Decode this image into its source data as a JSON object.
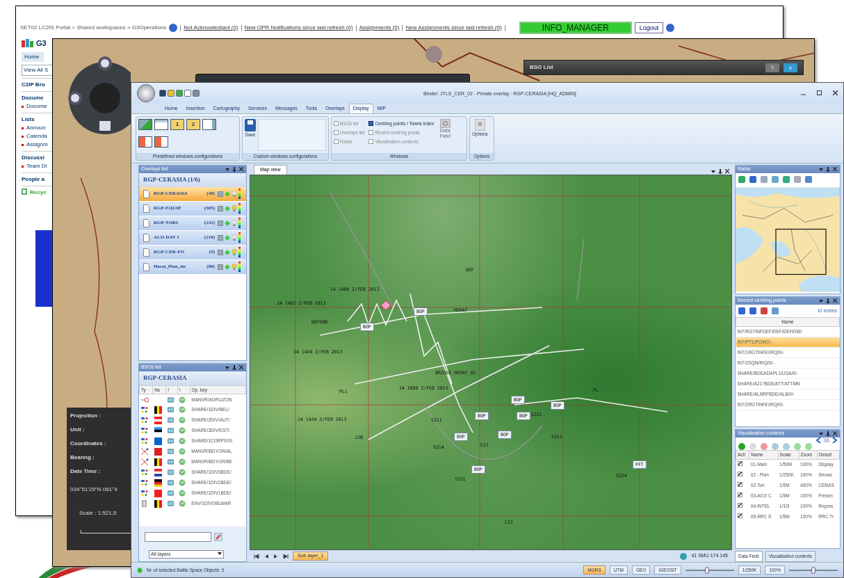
{
  "portal_window": {
    "breadcrumb": "SET02 LC2IS Portal > Shared workspaces > G3Operations",
    "links": [
      "Not Acknowledged (0)",
      "New OPR Notifications since last refresh (0)",
      "Assignments (0)",
      "New Assignments since last refresh (0)"
    ],
    "user": "INFO_MANAGER",
    "logout": "Logout",
    "site_title": "G3",
    "nav_tab": "Home",
    "quick_launch": [
      {
        "kind": "link",
        "text": "View All S"
      },
      {
        "kind": "heading",
        "text": "C2IP Bro"
      },
      {
        "kind": "heading",
        "text": "Docume"
      },
      {
        "kind": "item",
        "text": "Docume"
      },
      {
        "kind": "heading",
        "text": "Lists"
      },
      {
        "kind": "item",
        "text": "Announ"
      },
      {
        "kind": "item",
        "text": "Calenda"
      },
      {
        "kind": "item",
        "text": "Assignm"
      },
      {
        "kind": "heading",
        "text": "Discussi"
      },
      {
        "kind": "item",
        "text": "Team Di"
      },
      {
        "kind": "heading",
        "text": "People a"
      },
      {
        "kind": "recycle",
        "text": "Recyc"
      }
    ]
  },
  "map_window": {
    "dialog_title": "BSO List",
    "dialog_help": "?",
    "dialog_close": "x",
    "info_labels": [
      "Projection :",
      "Unit :",
      "Coordinates :",
      "Bearing :",
      "Date Time :"
    ],
    "coordinates": "034°51'29\"N 061°4",
    "scale": "Scale : 1:521,5"
  },
  "app_window": {
    "title": "Binder: JTLS_CER_02 - Private overlay : RGP-CERASIA [HQ_ADMIN]",
    "tabs": [
      {
        "label": "Home",
        "selected": false
      },
      {
        "label": "Insertion",
        "selected": false
      },
      {
        "label": "Cartography",
        "selected": false
      },
      {
        "label": "Services",
        "selected": false
      },
      {
        "label": "Messages",
        "selected": false
      },
      {
        "label": "Tools",
        "selected": false
      },
      {
        "label": "Overlays",
        "selected": false
      },
      {
        "label": "Display",
        "selected": true
      },
      {
        "label": "MIP",
        "selected": false
      }
    ],
    "ribbon": {
      "predefined": {
        "layouts": [
          {
            "kind": "check"
          },
          {
            "kind": "blank"
          },
          {
            "kind": "number",
            "label": "1"
          },
          {
            "kind": "number",
            "label": "2"
          },
          {
            "kind": "split"
          },
          {
            "kind": "arrow"
          },
          {
            "kind": "arrow"
          }
        ],
        "caption": "Predefined windows configurations"
      },
      "custom": {
        "save": "Save",
        "caption": "Custom windows configurations"
      },
      "windows": {
        "items": [
          {
            "label": "BSOs list",
            "checked": false
          },
          {
            "label": "Overlays list",
            "checked": false
          },
          {
            "label": "Radar",
            "checked": false
          },
          {
            "label": "Centring points / Towns index",
            "checked": true
          },
          {
            "label": "Recent centring points",
            "checked": false
          },
          {
            "label": "Visualisation contexts",
            "checked": false
          }
        ],
        "data_field": "Data Field",
        "caption": "Windows"
      },
      "options": {
        "button": "Options",
        "caption": "Options"
      }
    },
    "overlays": {
      "panel_title": "Overlays list",
      "header": "RGP-CERASIA (1/6)",
      "rows": [
        {
          "name": "RGP-CERASIA",
          "count": "(40)",
          "selected": true,
          "lamp_on": false
        },
        {
          "name": "RGP-EQUIP",
          "count": "(305)",
          "selected": false,
          "lamp_on": true
        },
        {
          "name": "RGP-TORI",
          "count": "(232)",
          "selected": false,
          "lamp_on": false
        },
        {
          "name": "ACO DAY 1",
          "count": "(210)",
          "selected": false,
          "lamp_on": false
        },
        {
          "name": "RGP-CER-EN",
          "count": "(9)",
          "selected": false,
          "lamp_on": true
        },
        {
          "name": "Herat_Plan_dn",
          "count": "(88)",
          "selected": false,
          "lamp_on": true
        }
      ]
    },
    "bsos": {
      "panel_title": "BSOs list",
      "header": "RGP-CERASIA",
      "columns": [
        "Ty",
        "No",
        "!",
        "\\",
        "Op. key"
      ],
      "rows": [
        {
          "kind": "route",
          "key": "MANVR/AOR1/ZON"
        },
        {
          "kind": "unit",
          "key": "SHARE/1DIV/BEL/"
        },
        {
          "kind": "unit",
          "key": "SHARE/2DIV/AUT/"
        },
        {
          "kind": "unit",
          "key": "SHARE/3DIV/EST/"
        },
        {
          "kind": "unit",
          "key": "SHARE/1CORPS/XI"
        },
        {
          "kind": "boundary",
          "key": "MANVR/BDYOR/AL"
        },
        {
          "kind": "boundary",
          "key": "MANVR/BDYOR/BE"
        },
        {
          "kind": "unit",
          "key": "SHARE/1DIV3BDE/"
        },
        {
          "kind": "unit",
          "key": "SHARE/1DIV2BDE/"
        },
        {
          "kind": "unit",
          "key": "SHARE/1DIV1BDE/"
        },
        {
          "kind": "env",
          "key": "ENV/1DIVOBLWAR"
        }
      ],
      "layer_filter": "All layers"
    },
    "map": {
      "tab": "Map view",
      "sub_layer": "Sub layer_1",
      "position": "41 SMU 174 145",
      "labels": [
        {
          "kind": "text",
          "text": "DEF"
        },
        {
          "kind": "text",
          "text": "HERAT"
        },
        {
          "kind": "text",
          "text": "14 1400 Z/FEB 2013"
        },
        {
          "kind": "text",
          "text": "14 1403 Z/FEB 2013"
        },
        {
          "kind": "text",
          "text": "DEFEND"
        },
        {
          "kind": "text",
          "text": "PL1"
        },
        {
          "kind": "text",
          "text": "BRIDGE_HERAT_01"
        },
        {
          "kind": "text",
          "text": "14 1434 Z/FEB 2013"
        },
        {
          "kind": "text",
          "text": "14 1600 Z/FEB 2013"
        },
        {
          "kind": "text",
          "text": "14 1434 Z/FEB 2013"
        },
        {
          "kind": "text",
          "text": "LOD"
        },
        {
          "kind": "text",
          "text": "S221"
        },
        {
          "kind": "text",
          "text": "S211"
        },
        {
          "kind": "text",
          "text": "S214"
        },
        {
          "kind": "text",
          "text": "C21"
        },
        {
          "kind": "text",
          "text": "S231"
        },
        {
          "kind": "text",
          "text": "C23"
        },
        {
          "kind": "text",
          "text": "S224"
        },
        {
          "kind": "text",
          "text": "S221"
        },
        {
          "kind": "text",
          "text": "PL"
        },
        {
          "kind": "box",
          "text": "BOP"
        },
        {
          "kind": "box",
          "text": "BOP"
        },
        {
          "kind": "box",
          "text": "BOP"
        },
        {
          "kind": "box",
          "text": "BOP"
        },
        {
          "kind": "box",
          "text": "BOP"
        },
        {
          "kind": "box",
          "text": "BOP"
        },
        {
          "kind": "box",
          "text": "BOP"
        },
        {
          "kind": "box",
          "text": "BOP"
        },
        {
          "kind": "box",
          "text": "BOP"
        },
        {
          "kind": "box",
          "text": "PFT"
        }
      ]
    },
    "radar": {
      "panel_title": "Radar"
    },
    "centring": {
      "panel_title": "Recent centring points",
      "entries": "10 entries",
      "column": "Name",
      "rows": [
        {
          "name": "INT/RGTINFDEF/DEF/DEFEND",
          "selected": false
        },
        {
          "name": "INT/PT1/POINT/-",
          "selected": true
        },
        {
          "name": "INT/1RGTINFE/IRQ/0/-",
          "selected": false
        },
        {
          "name": "INT/2SQN/IRQ/0/-",
          "selected": false
        },
        {
          "name": "SHARE/BDEADAPL1/USA/0/-",
          "selected": false
        },
        {
          "name": "SHARE/A21?BDE/ATT/ATTMN",
          "selected": false
        },
        {
          "name": "SHARE/ALNRFBDE/ALB/0/-",
          "selected": false
        },
        {
          "name": "INT/2RGTINFE/IRQ/0/-",
          "selected": false
        }
      ]
    },
    "contexts": {
      "panel_title": "Visualisation contexts",
      "check_column": "Acti",
      "columns": [
        "Name",
        "Scale",
        "Zoom",
        "Descri"
      ],
      "rows": [
        {
          "checked": true,
          "cells": [
            "01-Main",
            "1/50M",
            "100%",
            "Display"
          ]
        },
        {
          "checked": true,
          "cells": [
            "02 - Plan",
            "1/250K",
            "100%",
            "Shows"
          ]
        },
        {
          "checked": true,
          "cells": [
            "02-Tori",
            "1/5M",
            "400%",
            "CERAS"
          ]
        },
        {
          "checked": true,
          "cells": [
            "03-ACO C",
            "1/5M",
            "100%",
            "Presen"
          ]
        },
        {
          "checked": true,
          "cells": [
            "04-INTEL",
            "1/10I",
            "100%",
            "Repres"
          ]
        },
        {
          "checked": true,
          "cells": [
            "05-RRC S",
            "1/5M",
            "100%",
            "RRC Tr"
          ]
        }
      ],
      "tabs": [
        {
          "label": "Data Field",
          "selected": true
        },
        {
          "label": "Visualisation contexts",
          "selected": false
        }
      ]
    },
    "status_bar": {
      "text": "Nr. of selected Battle Space Objects: 0",
      "systems": [
        {
          "label": "MGRS",
          "selected": true
        },
        {
          "label": "UTM",
          "selected": false
        },
        {
          "label": "GEO",
          "selected": false
        },
        {
          "label": "IGEOSIT",
          "selected": false
        }
      ],
      "scale": "1/250K",
      "zoom": "100%",
      "sliders": [
        {
          "level": 0.45
        },
        {
          "level": 0.5
        }
      ]
    }
  }
}
